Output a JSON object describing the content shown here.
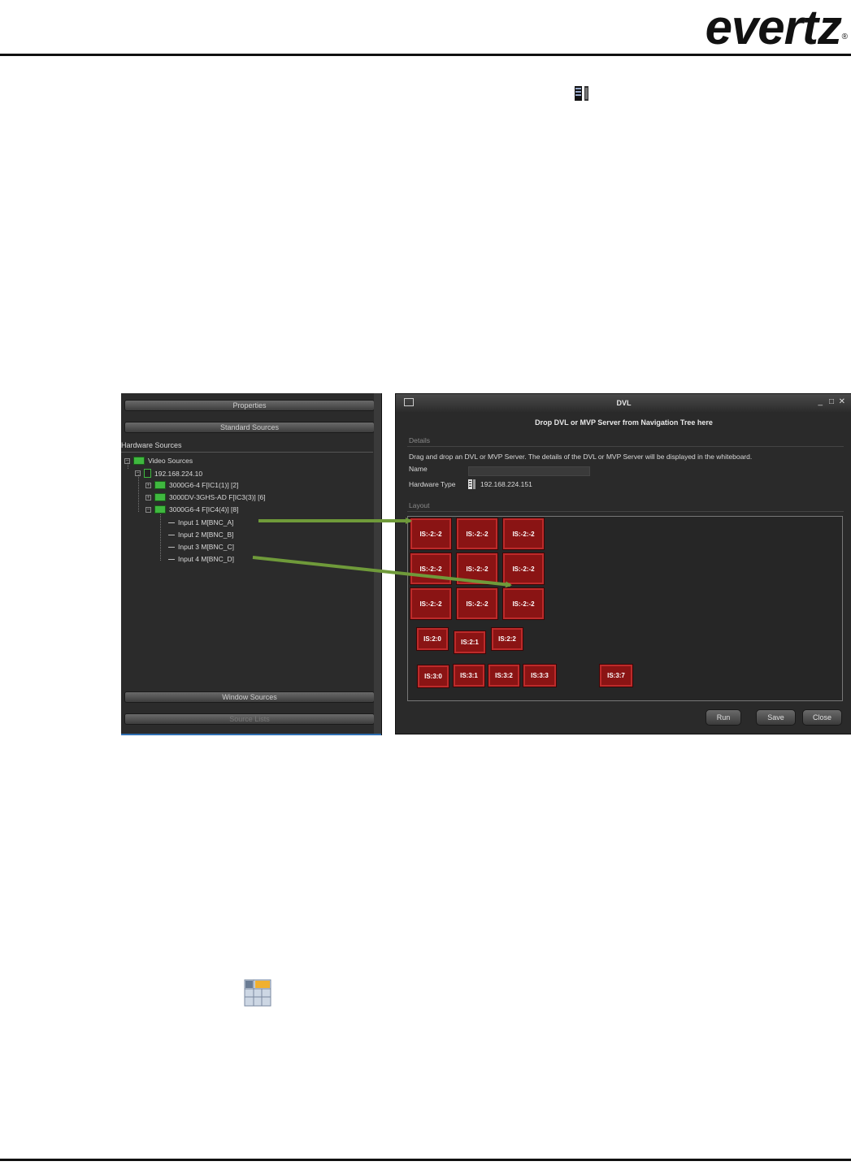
{
  "header": {
    "logo_text": "evertz",
    "registered": "®"
  },
  "left_panel": {
    "bars": {
      "properties": "Properties",
      "standard_sources": "Standard Sources",
      "window_sources": "Window Sources",
      "source_lists": "Source Lists"
    },
    "hardware_sources_label": "Hardware Sources",
    "tree": [
      {
        "label": "Video Sources",
        "icon": "card-icon",
        "expander": "−"
      },
      {
        "label": "192.168.224.10",
        "icon": "server-icon",
        "expander": "−"
      },
      {
        "label": "3000G6-4  F[IC1(1)]  [2]",
        "icon": "card-icon",
        "expander": "+"
      },
      {
        "label": "3000DV-3GHS-AD  F[IC3(3)]  [6]",
        "icon": "card-icon",
        "expander": "+"
      },
      {
        "label": "3000G6-4  F[IC4(4)]  [8]",
        "icon": "card-icon",
        "expander": "−"
      },
      {
        "label": "Input 1  M[BNC_A]",
        "icon": "input-arrow-icon"
      },
      {
        "label": "Input 2  M[BNC_B]",
        "icon": "input-arrow-icon"
      },
      {
        "label": "Input 3  M[BNC_C]",
        "icon": "input-arrow-icon"
      },
      {
        "label": "Input 4  M[BNC_D]",
        "icon": "input-arrow-icon"
      }
    ]
  },
  "dialog": {
    "title": "DVL",
    "controls": {
      "minimize": "_",
      "maximize": "□",
      "close": "✕"
    },
    "drop_banner": "Drop DVL or MVP Server from Navigation Tree here",
    "details_label": "Details",
    "details_text": "Drag and drop an DVL or MVP Server.  The details of the DVL or MVP Server will be displayed in the whiteboard.",
    "name_label": "Name",
    "name_value": "",
    "hardware_type_label": "Hardware Type",
    "hardware_type_value": "192.168.224.151",
    "layout_label": "Layout",
    "tiles": [
      "IS:-2:-2",
      "IS:-2:-2",
      "IS:-2:-2",
      "IS:-2:-2",
      "IS:-2:-2",
      "IS:-2:-2",
      "IS:-2:-2",
      "IS:-2:-2",
      "IS:-2:-2",
      "IS:2:0",
      "IS:2:1",
      "IS:2:2",
      "IS:3:0",
      "IS:3:1",
      "IS:3:2",
      "IS:3:3",
      "IS:3:7"
    ],
    "buttons": {
      "run": "Run",
      "save": "Save",
      "close": "Close"
    }
  },
  "colors": {
    "tile_fill": "#8a1414",
    "tile_border": "#bd2a2a",
    "arrow": "#6f9a3a",
    "panel_bg": "#2b2b2b"
  }
}
